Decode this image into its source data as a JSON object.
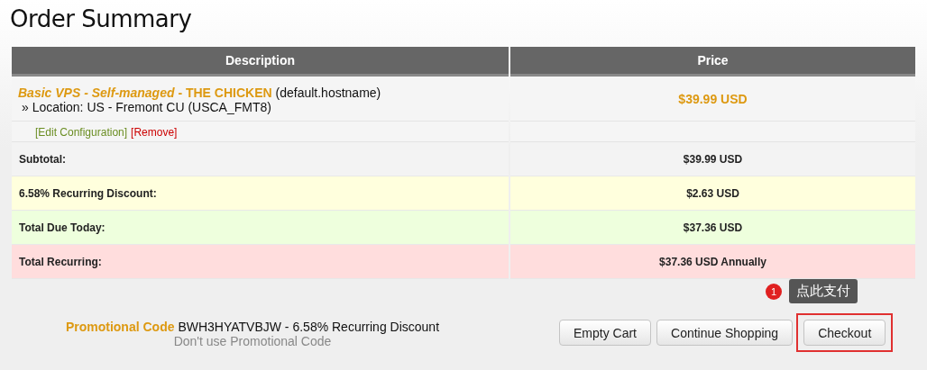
{
  "title": "Order Summary",
  "table": {
    "columns": [
      "Description",
      "Price"
    ],
    "item": {
      "product_group": "Basic VPS - Self-managed",
      "product_name": "- THE CHICKEN",
      "hostname": "(default.hostname)",
      "option": "» Location: US - Fremont CU (USCA_FMT8)",
      "price": "$39.99 USD",
      "links": [
        {
          "kind": "edit",
          "label": "[Edit Configuration]"
        },
        {
          "kind": "remove",
          "label": "[Remove]"
        }
      ]
    },
    "totals": [
      {
        "kind": "subtotal",
        "label": "Subtotal:",
        "value": "$39.99 USD"
      },
      {
        "kind": "discount",
        "label": "6.58% Recurring Discount:",
        "value": "$2.63 USD"
      },
      {
        "kind": "due",
        "label": "Total Due Today:",
        "value": "$37.36 USD"
      },
      {
        "kind": "recurring",
        "label": "Total Recurring:",
        "value": "$37.36 USD Annually"
      }
    ]
  },
  "promo": {
    "label": "Promotional Code",
    "code": "BWH3HYATVBJW - 6.58% Recurring Discount",
    "remove_link": "Don't use Promotional Code"
  },
  "buttons": [
    {
      "label": "Empty Cart",
      "highlighted": false
    },
    {
      "label": "Continue Shopping",
      "highlighted": false
    },
    {
      "label": "Checkout",
      "highlighted": true
    }
  ],
  "annotation": {
    "number": "1",
    "text": "点此支付"
  }
}
